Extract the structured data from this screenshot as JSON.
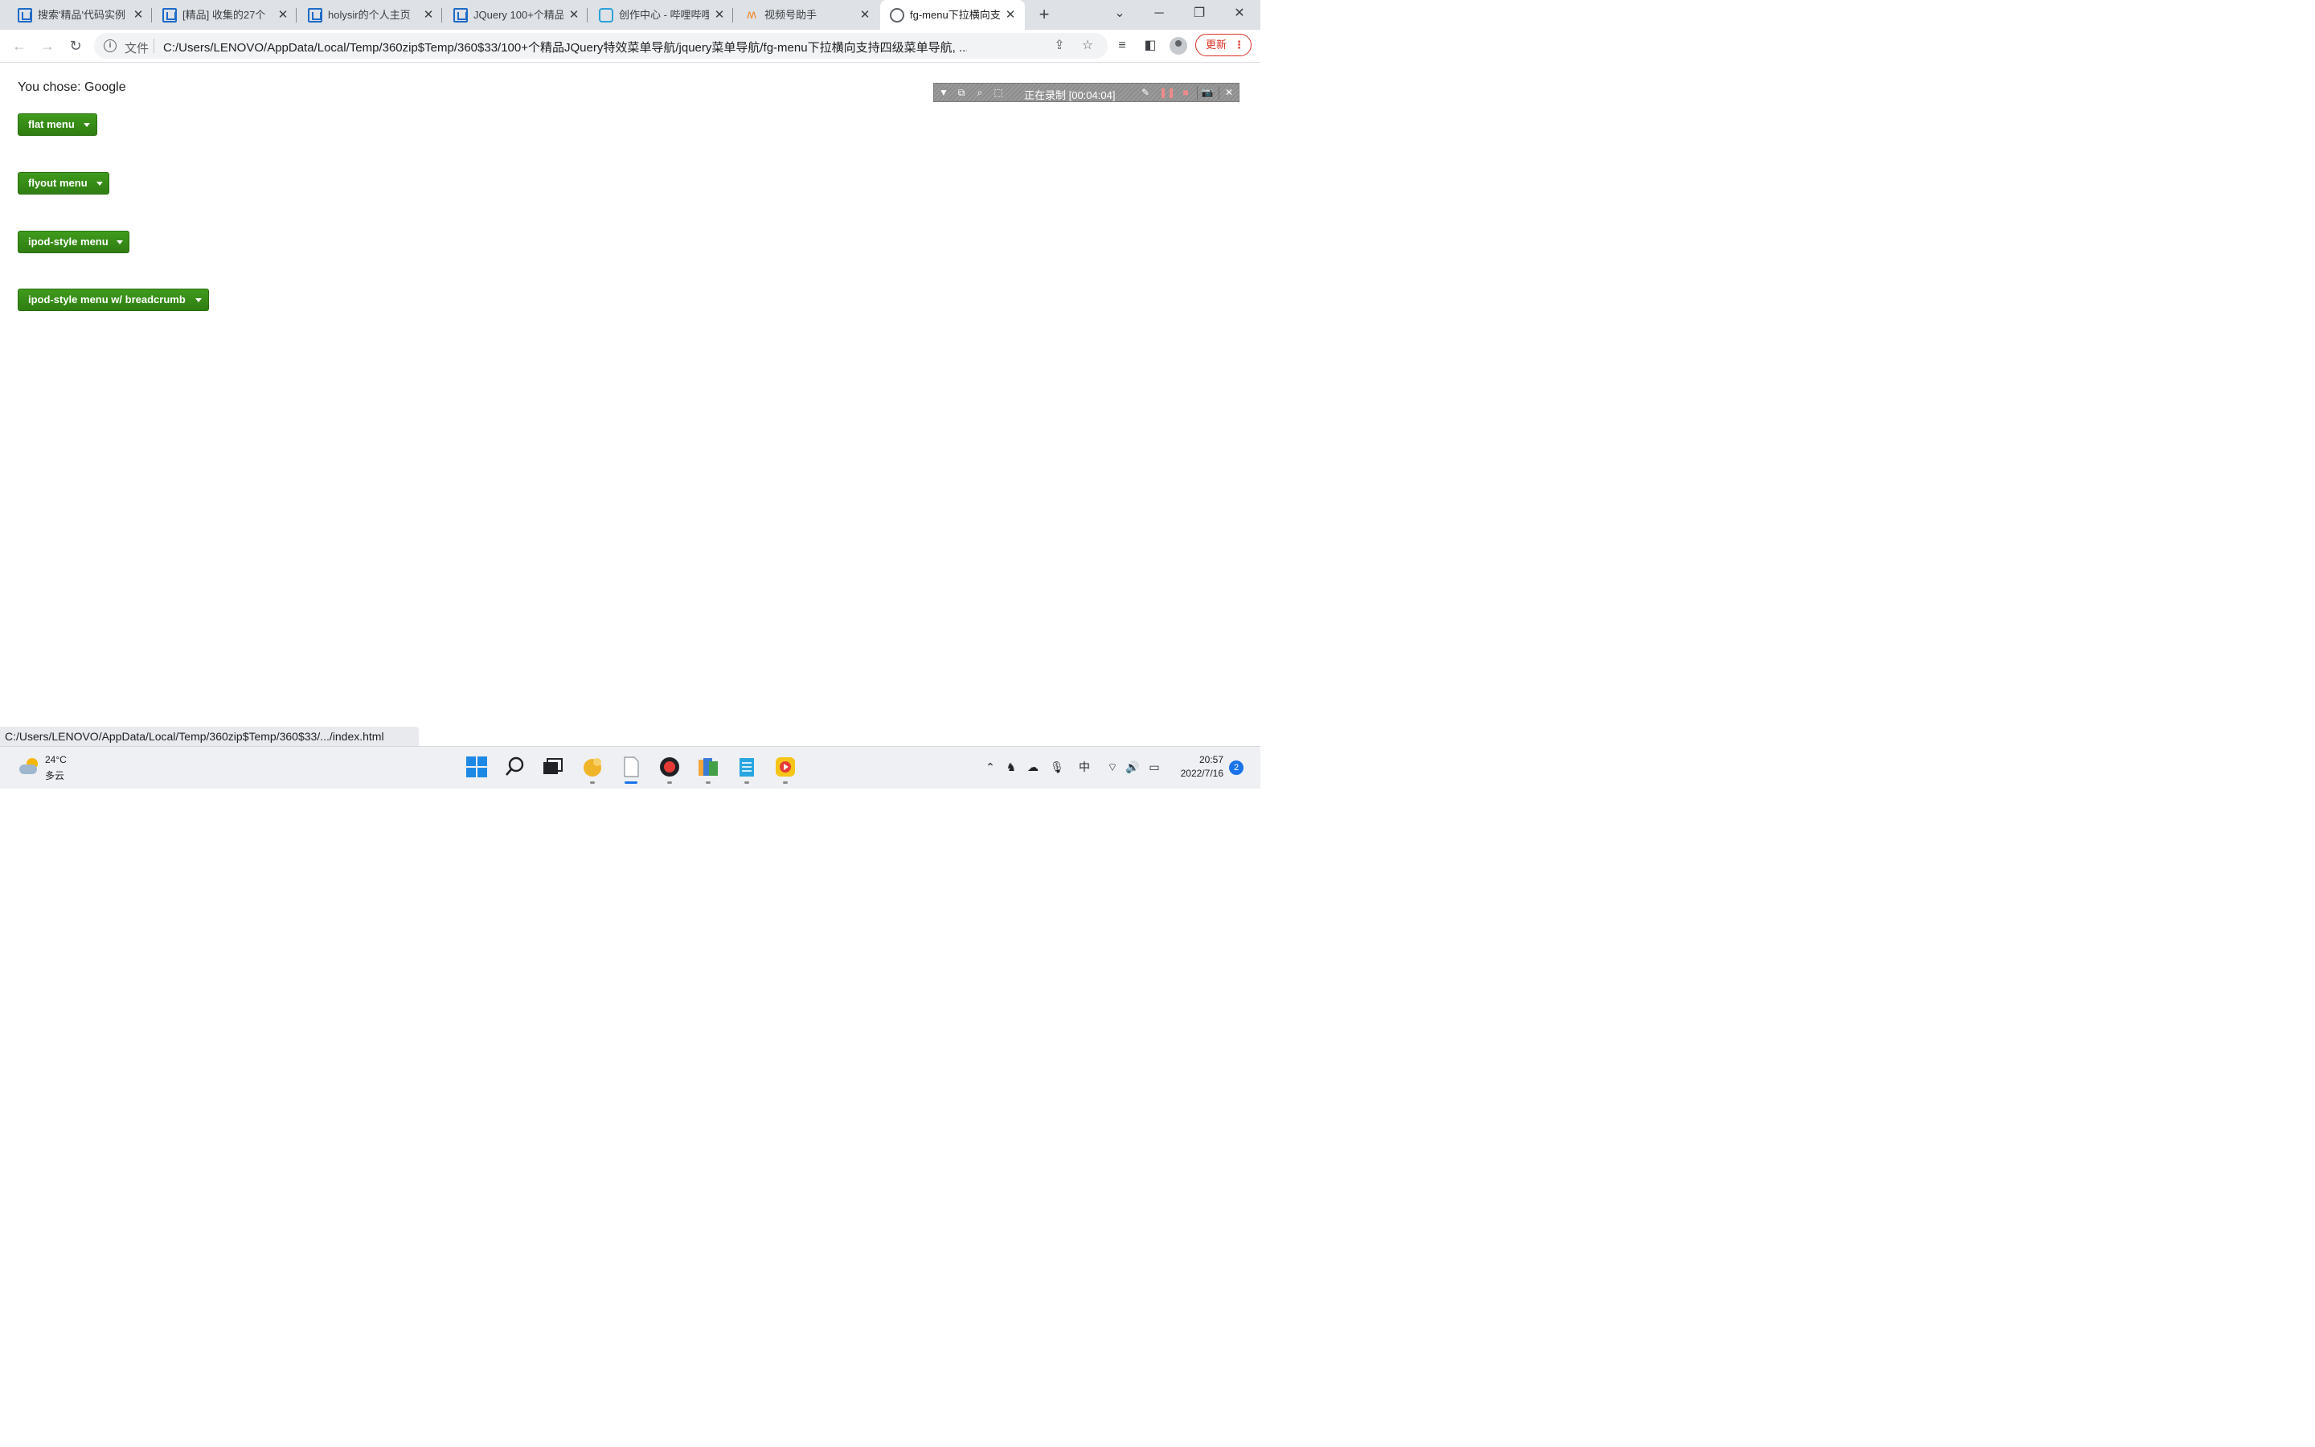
{
  "browser": {
    "tabs": [
      {
        "title": "搜索'精品'代码实例",
        "icon": "csdn-icon"
      },
      {
        "title": "[精品] 收集的27个",
        "icon": "csdn-icon"
      },
      {
        "title": "holysir的个人主页",
        "icon": "csdn-icon"
      },
      {
        "title": "JQuery 100+个精品",
        "icon": "csdn-icon"
      },
      {
        "title": "创作中心 - 哔哩哔哩",
        "icon": "bilibili-icon"
      },
      {
        "title": "视频号助手",
        "icon": "video-assistant-icon"
      },
      {
        "title": "fg-menu下拉横向支持",
        "icon": "globe-icon",
        "active": true
      }
    ],
    "address": {
      "scheme_label": "文件",
      "url": "C:/Users/LENOVO/AppData/Local/Temp/360zip$Temp/360$33/100+个精品JQuery特效菜单导航/jquery菜单导航/fg-menu下拉横向支持四级菜单导航, ..."
    },
    "update_label": "更新"
  },
  "page": {
    "chose_text": "You chose: Google",
    "menus": [
      {
        "label": "flat menu"
      },
      {
        "label": "flyout menu"
      },
      {
        "label": "ipod-style menu"
      },
      {
        "label": "ipod-style menu w/ breadcrumb"
      }
    ],
    "status_url": "C:/Users/LENOVO/AppData/Local/Temp/360zip$Temp/360$33/.../index.html"
  },
  "recorder": {
    "status": "正在录制 [00:04:04]"
  },
  "taskbar": {
    "weather": {
      "temp": "24°C",
      "condition": "多云"
    },
    "ime": "中",
    "time": "20:57",
    "date": "2022/7/16",
    "notifications": "2"
  },
  "colors": {
    "menu_button": "#348a17",
    "accent": "#1a73e8",
    "update": "#d93025"
  }
}
